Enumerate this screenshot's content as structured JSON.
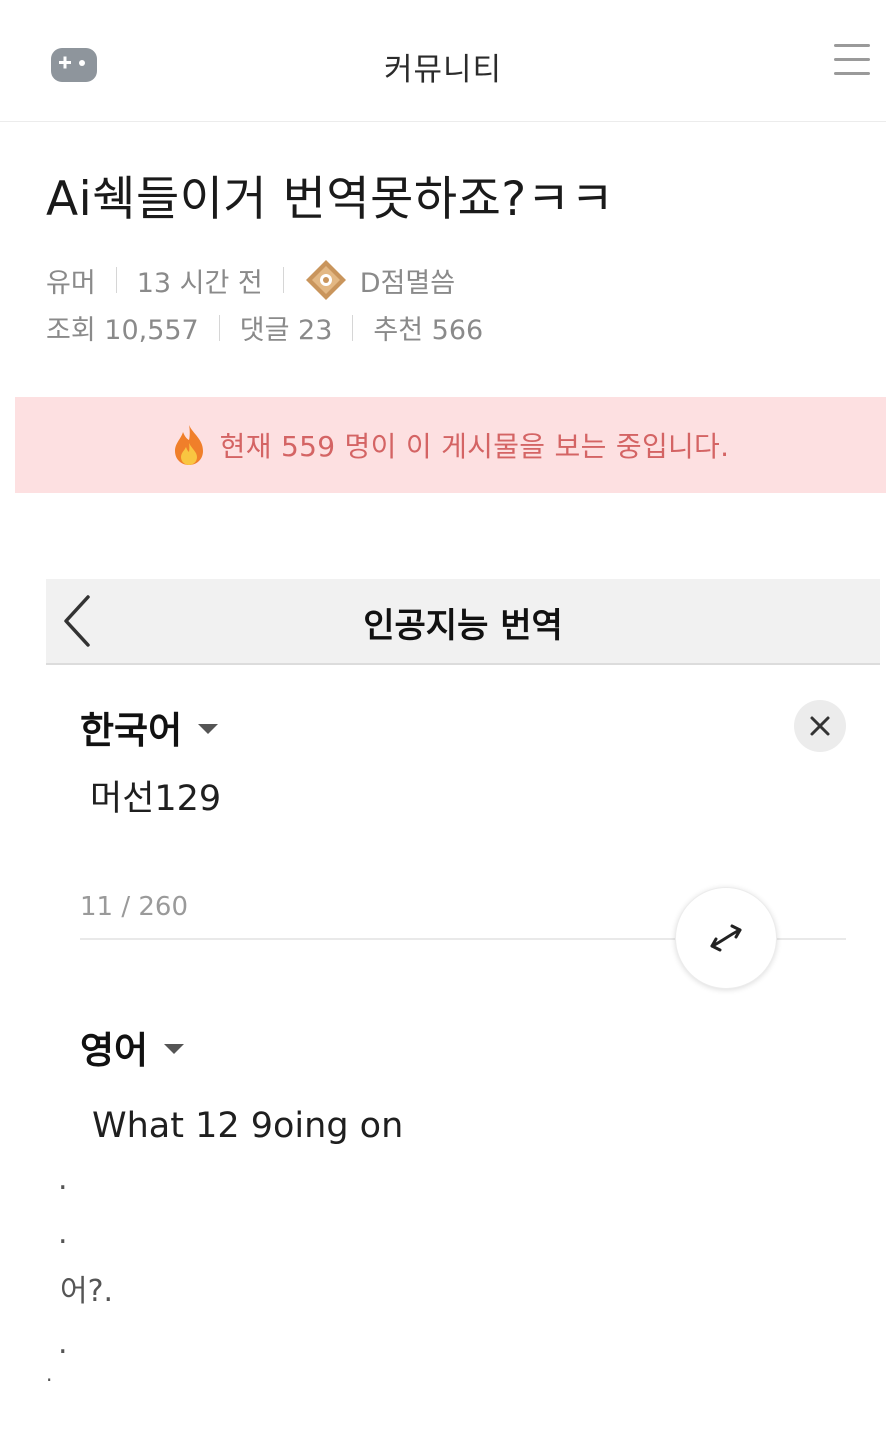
{
  "header": {
    "title": "커뮤니티"
  },
  "post": {
    "title": "Ai쉑들이거 번역못하죠?ㅋㅋ",
    "category": "유머",
    "time": "13 시간 전",
    "author": "D점멸씀",
    "views": "조회 10,557",
    "comments": "댓글 23",
    "recommends": "추천 566"
  },
  "live_banner": {
    "text": "현재 559 명이 이 게시물을 보는 중입니다."
  },
  "translator": {
    "title": "인공지능 번역",
    "source_lang": "한국어",
    "source_text": "머선129",
    "char_count": "11 / 260",
    "target_lang": "영어",
    "target_text": "What 12 9oing on"
  },
  "trailing": {
    "dot1": ".",
    "dot2": ".",
    "line": "어?.",
    "dot3": ".",
    "dot4": "."
  },
  "colors": {
    "banner_bg": "#fde0e1",
    "banner_text": "#d46464",
    "badge": "#c9955c"
  }
}
